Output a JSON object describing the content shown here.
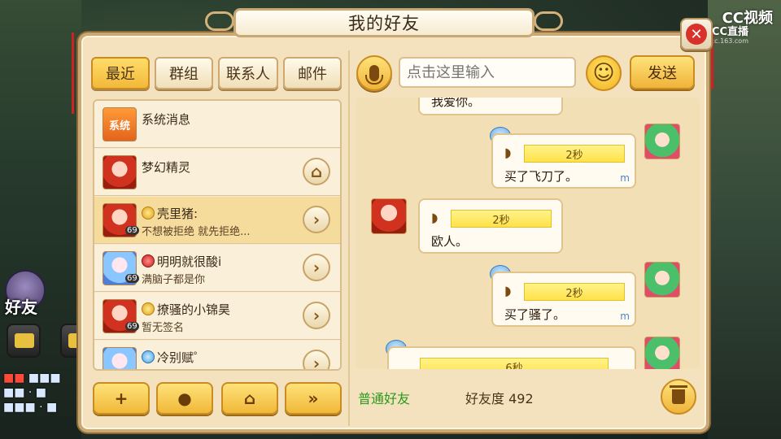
{
  "window": {
    "title": "我的好友",
    "close_icon": "close-icon"
  },
  "watermark": {
    "line1": "CC视频",
    "line2": "CC直播",
    "line3": "cc.163.com"
  },
  "hud": {
    "friend_label": "好友"
  },
  "tabs": [
    {
      "label": "最近",
      "active": true
    },
    {
      "label": "群组",
      "active": false
    },
    {
      "label": "联系人",
      "active": false
    },
    {
      "label": "邮件",
      "active": false
    }
  ],
  "contacts": [
    {
      "name": "系统消息",
      "avatar": "sys",
      "avatar_text": "系统",
      "sub": "",
      "level": "",
      "badge": "",
      "action": ""
    },
    {
      "name": "梦幻精灵",
      "avatar": "red",
      "sub": "",
      "level": "",
      "badge": "",
      "action": "home-icon"
    },
    {
      "name": "壳里猪:",
      "avatar": "red",
      "sub": "不想被拒绝 就先拒绝...",
      "level": "69",
      "badge": "gold",
      "action": "chevron-right-icon",
      "selected": true
    },
    {
      "name": "明明就很酸i",
      "avatar": "blue",
      "sub": "满脑子都是你",
      "level": "69",
      "badge": "redb",
      "action": "chevron-right-icon"
    },
    {
      "name": "撩骚的小锦昊",
      "avatar": "red",
      "sub": "暂无签名",
      "level": "69",
      "badge": "gold",
      "action": "chevron-right-icon"
    },
    {
      "name": "冷别赋゜",
      "avatar": "blue",
      "sub": "",
      "level": "",
      "badge": "blueb",
      "action": "chevron-right-icon"
    }
  ],
  "bottom_buttons": [
    {
      "icon": "add-friend-icon"
    },
    {
      "icon": "chat-bubble-icon"
    },
    {
      "icon": "home-icon"
    },
    {
      "icon": "fast-forward-icon"
    }
  ],
  "compose": {
    "placeholder": "点击这里输入",
    "send_label": "发送",
    "mic_icon": "microphone-icon",
    "emoji_icon": "smiley-icon"
  },
  "messages": [
    {
      "side": "right",
      "partial": true,
      "text": "我爱你。"
    },
    {
      "side": "right",
      "duration": "2秒",
      "text": "买了飞刀了。"
    },
    {
      "side": "left",
      "duration": "2秒",
      "text": "欧人。"
    },
    {
      "side": "right",
      "duration": "2秒",
      "text": "买了骚了。"
    },
    {
      "side": "right",
      "partial": true,
      "duration": "6秒",
      "text": ""
    }
  ],
  "footer": {
    "friend_type": "普通好友",
    "friendship_label": "好友度",
    "friendship_value": "492",
    "trash_icon": "trash-icon"
  },
  "colors": {
    "frame": "#f4e2bf",
    "accent_gold": "#f2b93a",
    "friend_type": "#2a9a1a",
    "close_red": "#d8322a"
  }
}
